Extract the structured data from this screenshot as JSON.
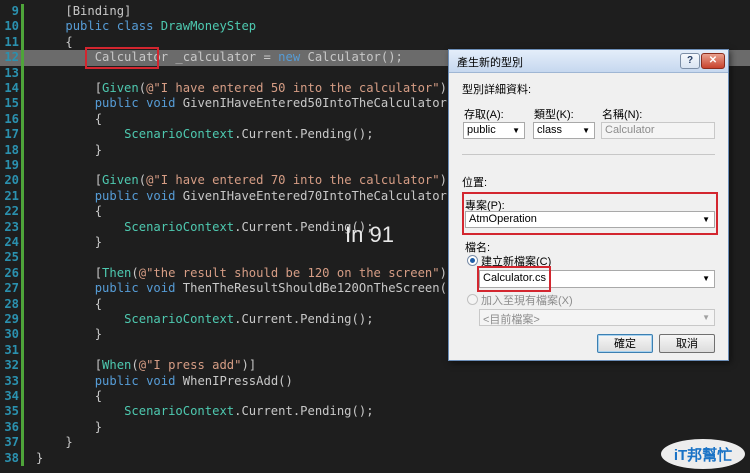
{
  "editor": {
    "lines": [
      {
        "num": "9",
        "tokens": [
          {
            "c": "n",
            "t": "    "
          },
          {
            "c": "n",
            "t": "[Binding]"
          }
        ]
      },
      {
        "num": "10",
        "tokens": [
          {
            "c": "n",
            "t": "    "
          },
          {
            "c": "k",
            "t": "public class "
          },
          {
            "c": "t",
            "t": "DrawMoneyStep"
          }
        ]
      },
      {
        "num": "11",
        "tokens": [
          {
            "c": "n",
            "t": "    {"
          }
        ]
      },
      {
        "num": "12",
        "tokens": [
          {
            "c": "n",
            "t": "        "
          },
          {
            "c": "n",
            "t": "Calculator"
          },
          {
            "c": "n",
            "t": " _calculator = "
          },
          {
            "c": "k",
            "t": "new "
          },
          {
            "c": "n",
            "t": "Calculator();"
          }
        ],
        "current": true
      },
      {
        "num": "13",
        "tokens": []
      },
      {
        "num": "14",
        "tokens": [
          {
            "c": "n",
            "t": "        ["
          },
          {
            "c": "t",
            "t": "Given"
          },
          {
            "c": "n",
            "t": "("
          },
          {
            "c": "s",
            "t": "@\"I have entered 50 into the calculator\""
          },
          {
            "c": "n",
            "t": ")]"
          }
        ]
      },
      {
        "num": "15",
        "tokens": [
          {
            "c": "n",
            "t": "        "
          },
          {
            "c": "k",
            "t": "public void "
          },
          {
            "c": "n",
            "t": "GivenIHaveEntered50IntoTheCalculator()"
          }
        ]
      },
      {
        "num": "16",
        "tokens": [
          {
            "c": "n",
            "t": "        {"
          }
        ]
      },
      {
        "num": "17",
        "tokens": [
          {
            "c": "n",
            "t": "            "
          },
          {
            "c": "t",
            "t": "ScenarioContext"
          },
          {
            "c": "n",
            "t": ".Current.Pending();"
          }
        ]
      },
      {
        "num": "18",
        "tokens": [
          {
            "c": "n",
            "t": "        }"
          }
        ]
      },
      {
        "num": "19",
        "tokens": []
      },
      {
        "num": "20",
        "tokens": [
          {
            "c": "n",
            "t": "        ["
          },
          {
            "c": "t",
            "t": "Given"
          },
          {
            "c": "n",
            "t": "("
          },
          {
            "c": "s",
            "t": "@\"I have entered 70 into the calculator\""
          },
          {
            "c": "n",
            "t": ")]"
          }
        ]
      },
      {
        "num": "21",
        "tokens": [
          {
            "c": "n",
            "t": "        "
          },
          {
            "c": "k",
            "t": "public void "
          },
          {
            "c": "n",
            "t": "GivenIHaveEntered70IntoTheCalculator()"
          }
        ]
      },
      {
        "num": "22",
        "tokens": [
          {
            "c": "n",
            "t": "        {"
          }
        ]
      },
      {
        "num": "23",
        "tokens": [
          {
            "c": "n",
            "t": "            "
          },
          {
            "c": "t",
            "t": "ScenarioContext"
          },
          {
            "c": "n",
            "t": ".Current.Pending();"
          }
        ]
      },
      {
        "num": "24",
        "tokens": [
          {
            "c": "n",
            "t": "        }"
          }
        ]
      },
      {
        "num": "25",
        "tokens": []
      },
      {
        "num": "26",
        "tokens": [
          {
            "c": "n",
            "t": "        ["
          },
          {
            "c": "t",
            "t": "Then"
          },
          {
            "c": "n",
            "t": "("
          },
          {
            "c": "s",
            "t": "@\"the result should be 120 on the screen\""
          },
          {
            "c": "n",
            "t": ")]"
          }
        ]
      },
      {
        "num": "27",
        "tokens": [
          {
            "c": "n",
            "t": "        "
          },
          {
            "c": "k",
            "t": "public void "
          },
          {
            "c": "n",
            "t": "ThenTheResultShouldBe120OnTheScreen()"
          }
        ]
      },
      {
        "num": "28",
        "tokens": [
          {
            "c": "n",
            "t": "        {"
          }
        ]
      },
      {
        "num": "29",
        "tokens": [
          {
            "c": "n",
            "t": "            "
          },
          {
            "c": "t",
            "t": "ScenarioContext"
          },
          {
            "c": "n",
            "t": ".Current.Pending();"
          }
        ]
      },
      {
        "num": "30",
        "tokens": [
          {
            "c": "n",
            "t": "        }"
          }
        ]
      },
      {
        "num": "31",
        "tokens": []
      },
      {
        "num": "32",
        "tokens": [
          {
            "c": "n",
            "t": "        ["
          },
          {
            "c": "t",
            "t": "When"
          },
          {
            "c": "n",
            "t": "("
          },
          {
            "c": "s",
            "t": "@\"I press add\""
          },
          {
            "c": "n",
            "t": ")]"
          }
        ]
      },
      {
        "num": "33",
        "tokens": [
          {
            "c": "n",
            "t": "        "
          },
          {
            "c": "k",
            "t": "public void "
          },
          {
            "c": "n",
            "t": "WhenIPressAdd()"
          }
        ]
      },
      {
        "num": "34",
        "tokens": [
          {
            "c": "n",
            "t": "        {"
          }
        ]
      },
      {
        "num": "35",
        "tokens": [
          {
            "c": "n",
            "t": "            "
          },
          {
            "c": "t",
            "t": "ScenarioContext"
          },
          {
            "c": "n",
            "t": ".Current.Pending();"
          }
        ]
      },
      {
        "num": "36",
        "tokens": [
          {
            "c": "n",
            "t": "        }"
          }
        ]
      },
      {
        "num": "37",
        "tokens": [
          {
            "c": "n",
            "t": "    }"
          }
        ]
      },
      {
        "num": "38",
        "tokens": [
          {
            "c": "n",
            "t": "}"
          }
        ]
      }
    ],
    "overlay_text": "In 91"
  },
  "dialog": {
    "title": "產生新的型別",
    "help_button": "?",
    "close_button": "✕",
    "details_heading": "型別詳細資料:",
    "access_label": "存取(A):",
    "access_value": "public",
    "kind_label": "類型(K):",
    "kind_value": "class",
    "name_label": "名稱(N):",
    "name_value": "Calculator",
    "location_heading": "位置:",
    "project_label": "專案(P):",
    "project_value": "AtmOperation",
    "filename_label": "檔名:",
    "create_new_file_label": "建立新檔案(C)",
    "create_new_file_value": "Calculator.cs",
    "add_existing_label": "加入至現有檔案(X)",
    "existing_file_value": "<目前檔案>",
    "ok_label": "確定",
    "cancel_label": "取消"
  },
  "watermark": {
    "text": "iT邦幫忙"
  },
  "colors": {
    "background": "#1e1e1e",
    "keyword": "#569cd6",
    "type": "#4ec9b0",
    "string": "#d69d85",
    "line_number": "#2b91af",
    "highlight_box": "#d3262f"
  }
}
